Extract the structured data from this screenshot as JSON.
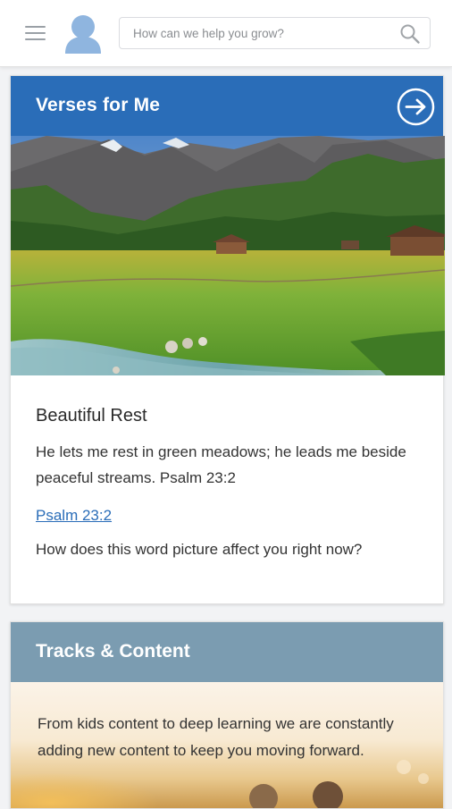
{
  "header": {
    "menu_icon": "hamburger-menu-icon",
    "avatar_icon": "user-avatar-icon",
    "search": {
      "placeholder": "How can we help you grow?",
      "icon": "search-icon"
    }
  },
  "verses_card": {
    "title": "Verses for Me",
    "header_color": "#2a6db8",
    "action_icon": "arrow-right-circle-icon",
    "image": "mountain-meadow-stream-image",
    "verse_title": "Beautiful Rest",
    "verse_text": "He lets me rest in green meadows; he leads me beside peaceful streams. Psalm 23:2",
    "link_label": "Psalm 23:2",
    "question": "How does this word picture affect you right now?"
  },
  "tracks_card": {
    "title": "Tracks & Content",
    "header_color": "#7b9cb1",
    "description": "From kids content to deep learning we are constantly adding new content to keep you moving forward."
  }
}
